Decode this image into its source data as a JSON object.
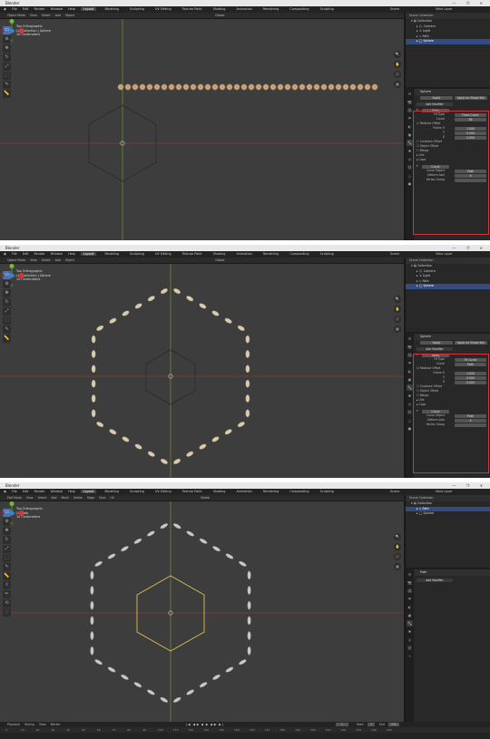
{
  "window": {
    "title": "Blender",
    "controls": "— ❐ ✕"
  },
  "menu": {
    "items": [
      "File",
      "Edit",
      "Render",
      "Window",
      "Help"
    ],
    "workspaces": [
      "Layout",
      "Modeling",
      "Sculpting",
      "UV Editing",
      "Texture Paint",
      "Shading",
      "Animation",
      "Rendering",
      "Compositing",
      "Scripting"
    ],
    "active_workspace": "Layout",
    "scene": "Scene",
    "view_layer": "View Layer"
  },
  "header_object": {
    "mode": "Object Mode",
    "items": [
      "View",
      "Select",
      "Add",
      "Object"
    ],
    "transform": "Global"
  },
  "header_edit": {
    "mode": "Edit Mode",
    "items": [
      "View",
      "Select",
      "Add",
      "Mesh",
      "Vertex",
      "Edge",
      "Face",
      "UV"
    ],
    "transform": "Global"
  },
  "viewport": {
    "view_name": "Top Orthographic",
    "collection_line_1": "(1) Collection | Sphere",
    "collection_line_3": "(1) Path",
    "units": "10 Centimeters"
  },
  "outliner": {
    "title": "Scene Collection",
    "rows": [
      "Collection",
      "Camera",
      "Light",
      "Path",
      "Sphere"
    ],
    "rows_3": [
      "Collection",
      "Path",
      "Sphere"
    ]
  },
  "props": {
    "object": "Sphere",
    "object_3": "Path",
    "add_modifier": "Add Modifier",
    "apply": "Apply",
    "apply_as_shape": "Apply as Shape Key",
    "copy": "Copy",
    "modifier_array": "Array",
    "fit_type_label": "Fit Type",
    "fit_type_value_1": "Fixed Count",
    "fit_type_value_2": "Fit Curve",
    "count_label": "Count",
    "count_value": "36",
    "curve_label": "Curve",
    "curve_value": "Path",
    "relative_offset": "Relative Offset",
    "factor_label": "Factor X",
    "y_label": "Y",
    "z_label": "Z",
    "factor_x": "1.000",
    "factor_y": "0.000",
    "factor_z": "0.000",
    "constant_offset": "Constant Offset",
    "object_offset": "Object Offset",
    "merge": "Merge",
    "uvs": "UVs",
    "caps": "Caps",
    "modifier_curve": "Curve",
    "curve_object_label": "Curve Object",
    "curve_object_value": "Path",
    "deform_axis_label": "Deform Axis",
    "deform_axis_value": "X",
    "vertex_group_label": "Vertex Group"
  },
  "timeline": {
    "items": [
      "Playback",
      "Keying",
      "View",
      "Marker"
    ],
    "current_frame": "1",
    "start_label": "Start",
    "start": "1",
    "end_label": "End",
    "end": "250",
    "play_controls": "|◀ ◀◀ ◀ ▶ ▶▶ ▶|",
    "ticks": [
      "0",
      "10",
      "20",
      "30",
      "40",
      "50",
      "60",
      "70",
      "80",
      "90",
      "100",
      "110",
      "120",
      "130",
      "140",
      "150",
      "160",
      "170",
      "180",
      "190",
      "200",
      "210",
      "220",
      "230",
      "240",
      "250"
    ]
  }
}
